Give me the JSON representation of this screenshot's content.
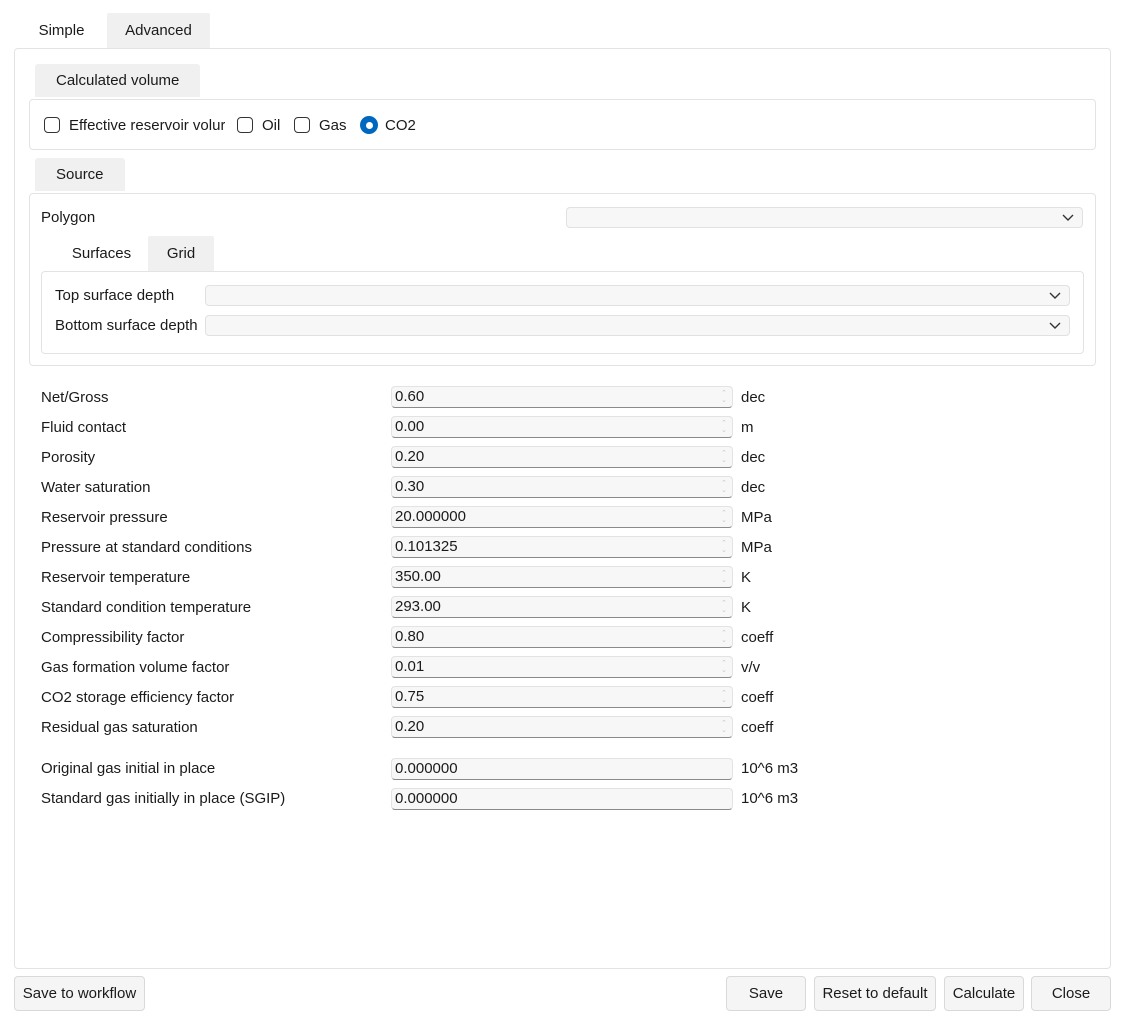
{
  "tabs": [
    {
      "label": "Simple"
    },
    {
      "label": "Advanced"
    }
  ],
  "calc_volume": {
    "title": "Calculated volume",
    "options": [
      {
        "label": "Effective reservoir volur",
        "checked": false
      },
      {
        "label": "Oil",
        "checked": false
      },
      {
        "label": "Gas",
        "checked": false
      },
      {
        "label": "CO2",
        "checked": true
      }
    ]
  },
  "source": {
    "title": "Source",
    "polygon_label": "Polygon",
    "polygon_value": "",
    "subtabs": [
      {
        "label": "Surfaces"
      },
      {
        "label": "Grid"
      }
    ],
    "top_label": "Top surface depth",
    "bottom_label": "Bottom surface depth"
  },
  "params": [
    {
      "label": "Net/Gross",
      "value": "0.60",
      "unit": "dec"
    },
    {
      "label": "Fluid contact",
      "value": "0.00",
      "unit": "m"
    },
    {
      "label": "Porosity",
      "value": "0.20",
      "unit": "dec"
    },
    {
      "label": "Water saturation",
      "value": "0.30",
      "unit": "dec"
    },
    {
      "label": "Reservoir pressure",
      "value": "20.000000",
      "unit": "MPa"
    },
    {
      "label": "Pressure at standard conditions",
      "value": "0.101325",
      "unit": "MPa"
    },
    {
      "label": "Reservoir temperature",
      "value": "350.00",
      "unit": "K"
    },
    {
      "label": "Standard condition temperature",
      "value": "293.00",
      "unit": "K"
    },
    {
      "label": "Compressibility factor",
      "value": "0.80",
      "unit": "coeff"
    },
    {
      "label": "Gas formation volume factor",
      "value": "0.01",
      "unit": "v/v"
    },
    {
      "label": "CO2 storage efficiency factor",
      "value": "0.75",
      "unit": "coeff"
    },
    {
      "label": "Residual gas saturation",
      "value": "0.20",
      "unit": "coeff"
    }
  ],
  "results": [
    {
      "label": "Original gas initial in place",
      "value": "0.000000",
      "unit": "10^6 m3"
    },
    {
      "label": "Standard gas initially in place (SGIP)",
      "value": "0.000000",
      "unit": "10^6 m3"
    }
  ],
  "buttons": {
    "save_to_workflow": "Save to workflow",
    "save": "Save",
    "reset": "Reset to default",
    "calculate": "Calculate",
    "close": "Close"
  },
  "colors": {
    "accent": "#0067c0"
  }
}
